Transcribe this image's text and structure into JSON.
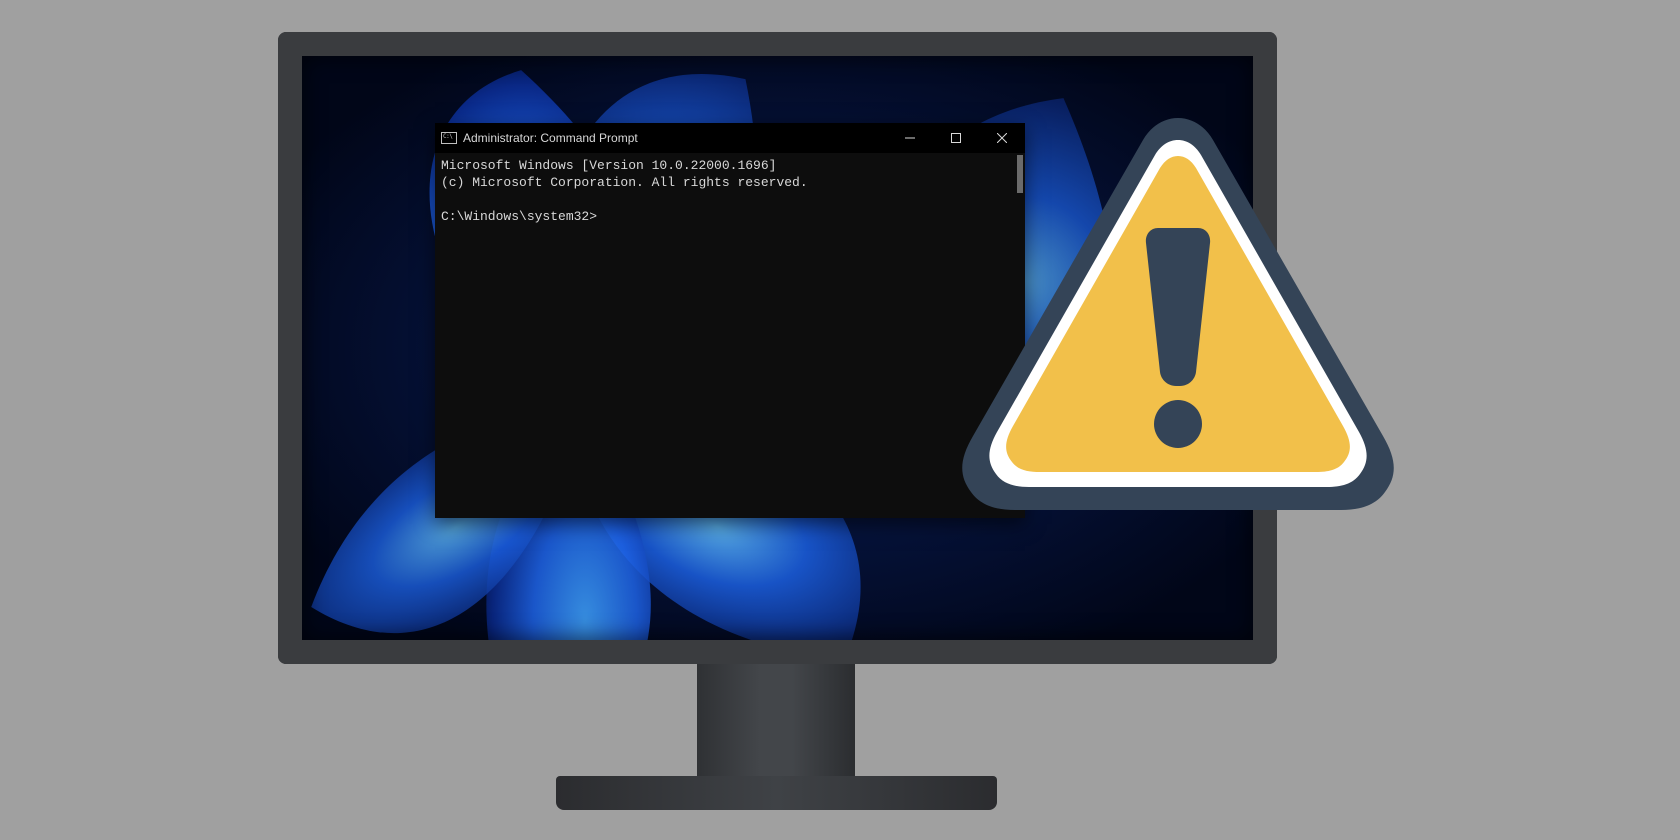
{
  "cmd": {
    "title": "Administrator: Command Prompt",
    "line1": "Microsoft Windows [Version 10.0.22000.1696]",
    "line2": "(c) Microsoft Corporation. All rights reserved.",
    "prompt": "C:\\Windows\\system32>"
  },
  "icons": {
    "cmd": "cmd-window-icon",
    "minimize": "minimize-icon",
    "maximize": "maximize-icon",
    "close": "close-icon",
    "warning": "warning-icon"
  },
  "colors": {
    "canvas": "#a0a0a0",
    "monitor_frame": "#3a3c3f",
    "cmd_bg": "#0d0d0d",
    "cmd_text": "#d8d8d8",
    "warning_fill": "#f2c04a",
    "warning_border": "#344457",
    "warning_inner_stroke": "#ffffff",
    "warning_mark": "#344457"
  }
}
